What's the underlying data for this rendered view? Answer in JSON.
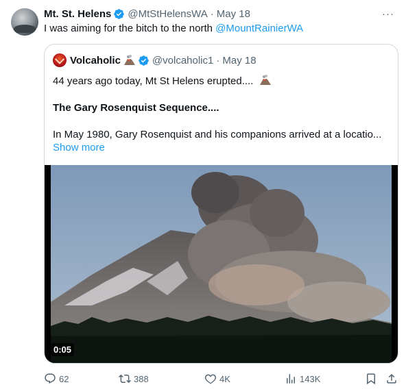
{
  "tweet": {
    "author_name": "Mt. St. Helens",
    "author_handle": "@MtStHelensWA",
    "separator": "·",
    "date": "May 18",
    "more_glyph": "···",
    "text_plain": "I was aiming for the bitch to the north ",
    "text_mention": "@MountRainierWA"
  },
  "quote": {
    "author_name": "Volcaholic",
    "author_handle": "@volcaholic1",
    "separator": "·",
    "date": "May 18",
    "line1": "44 years ago today, Mt St Helens erupted....",
    "title": "The Gary Rosenquist Sequence....",
    "body": "In May 1980, Gary Rosenquist and his companions arrived at a locatio...",
    "show_more": "Show more",
    "video_duration": "0:05"
  },
  "actions": {
    "replies": "62",
    "reposts": "388",
    "likes": "4K",
    "views": "143K"
  },
  "colors": {
    "accent": "#1d9bf0",
    "secondary_text": "#536471",
    "border": "#cfd9de",
    "verified": "#1d9bf0"
  },
  "icons": [
    "verified-badge-icon",
    "volcano-emoji-icon",
    "reply-icon",
    "repost-icon",
    "like-icon",
    "views-icon",
    "bookmark-icon",
    "share-icon",
    "more-icon"
  ]
}
